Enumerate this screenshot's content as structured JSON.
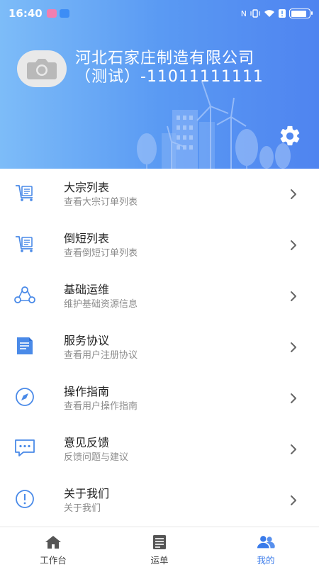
{
  "status_bar": {
    "time": "16:40",
    "battery_level": 0.85
  },
  "profile": {
    "company_line1": "河北石家庄制造有限公司",
    "company_line2": "（测试）-11011111111"
  },
  "menu": {
    "items": [
      {
        "title": "大宗列表",
        "subtitle": "查看大宗订单列表",
        "icon": "trolley-icon"
      },
      {
        "title": "倒短列表",
        "subtitle": "查看倒短订单列表",
        "icon": "trolley-icon"
      },
      {
        "title": "基础运维",
        "subtitle": "维护基础资源信息",
        "icon": "network-icon"
      },
      {
        "title": "服务协议",
        "subtitle": "查看用户注册协议",
        "icon": "document-icon"
      },
      {
        "title": "操作指南",
        "subtitle": "查看用户操作指南",
        "icon": "compass-icon"
      },
      {
        "title": "意见反馈",
        "subtitle": "反馈问题与建议",
        "icon": "chat-icon"
      },
      {
        "title": "关于我们",
        "subtitle": "关于我们",
        "icon": "info-icon"
      }
    ]
  },
  "tabbar": {
    "tabs": [
      {
        "label": "工作台",
        "icon": "home-icon",
        "active": false
      },
      {
        "label": "运单",
        "icon": "waybill-icon",
        "active": false
      },
      {
        "label": "我的",
        "icon": "users-icon",
        "active": true
      }
    ]
  },
  "colors": {
    "accent": "#3a7bea",
    "icon_blue": "#4a8ae8",
    "header_start": "#7dbcf8",
    "header_end": "#4f84f0"
  }
}
